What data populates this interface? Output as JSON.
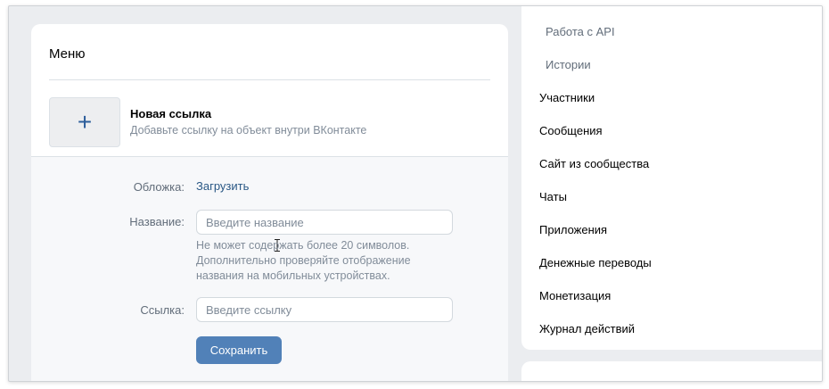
{
  "menu": {
    "title": "Меню",
    "new_link": {
      "title": "Новая ссылка",
      "subtitle": "Добавьте ссылку на объект внутри ВКонтакте",
      "plus_icon": "+"
    },
    "form": {
      "cover_label": "Обложка:",
      "cover_action": "Загрузить",
      "name_label": "Название:",
      "name_placeholder": "Введите название",
      "name_value": "",
      "name_hint": "Не может содержать более 20 символов. Дополнительно проверяйте отображение названия на мобильных устройствах.",
      "link_label": "Ссылка:",
      "link_placeholder": "Введите ссылку",
      "link_value": "",
      "save_label": "Сохранить"
    }
  },
  "sidebar": {
    "sub_items": [
      {
        "label": "Работа с API"
      },
      {
        "label": "Истории"
      }
    ],
    "items": [
      {
        "label": "Участники"
      },
      {
        "label": "Сообщения"
      },
      {
        "label": "Сайт из сообщества"
      },
      {
        "label": "Чаты"
      },
      {
        "label": "Приложения"
      },
      {
        "label": "Денежные переводы"
      },
      {
        "label": "Монетизация"
      },
      {
        "label": "Журнал действий"
      }
    ]
  },
  "colors": {
    "accent": "#5181b8",
    "link": "#2a5885",
    "background": "#ebedf0"
  }
}
